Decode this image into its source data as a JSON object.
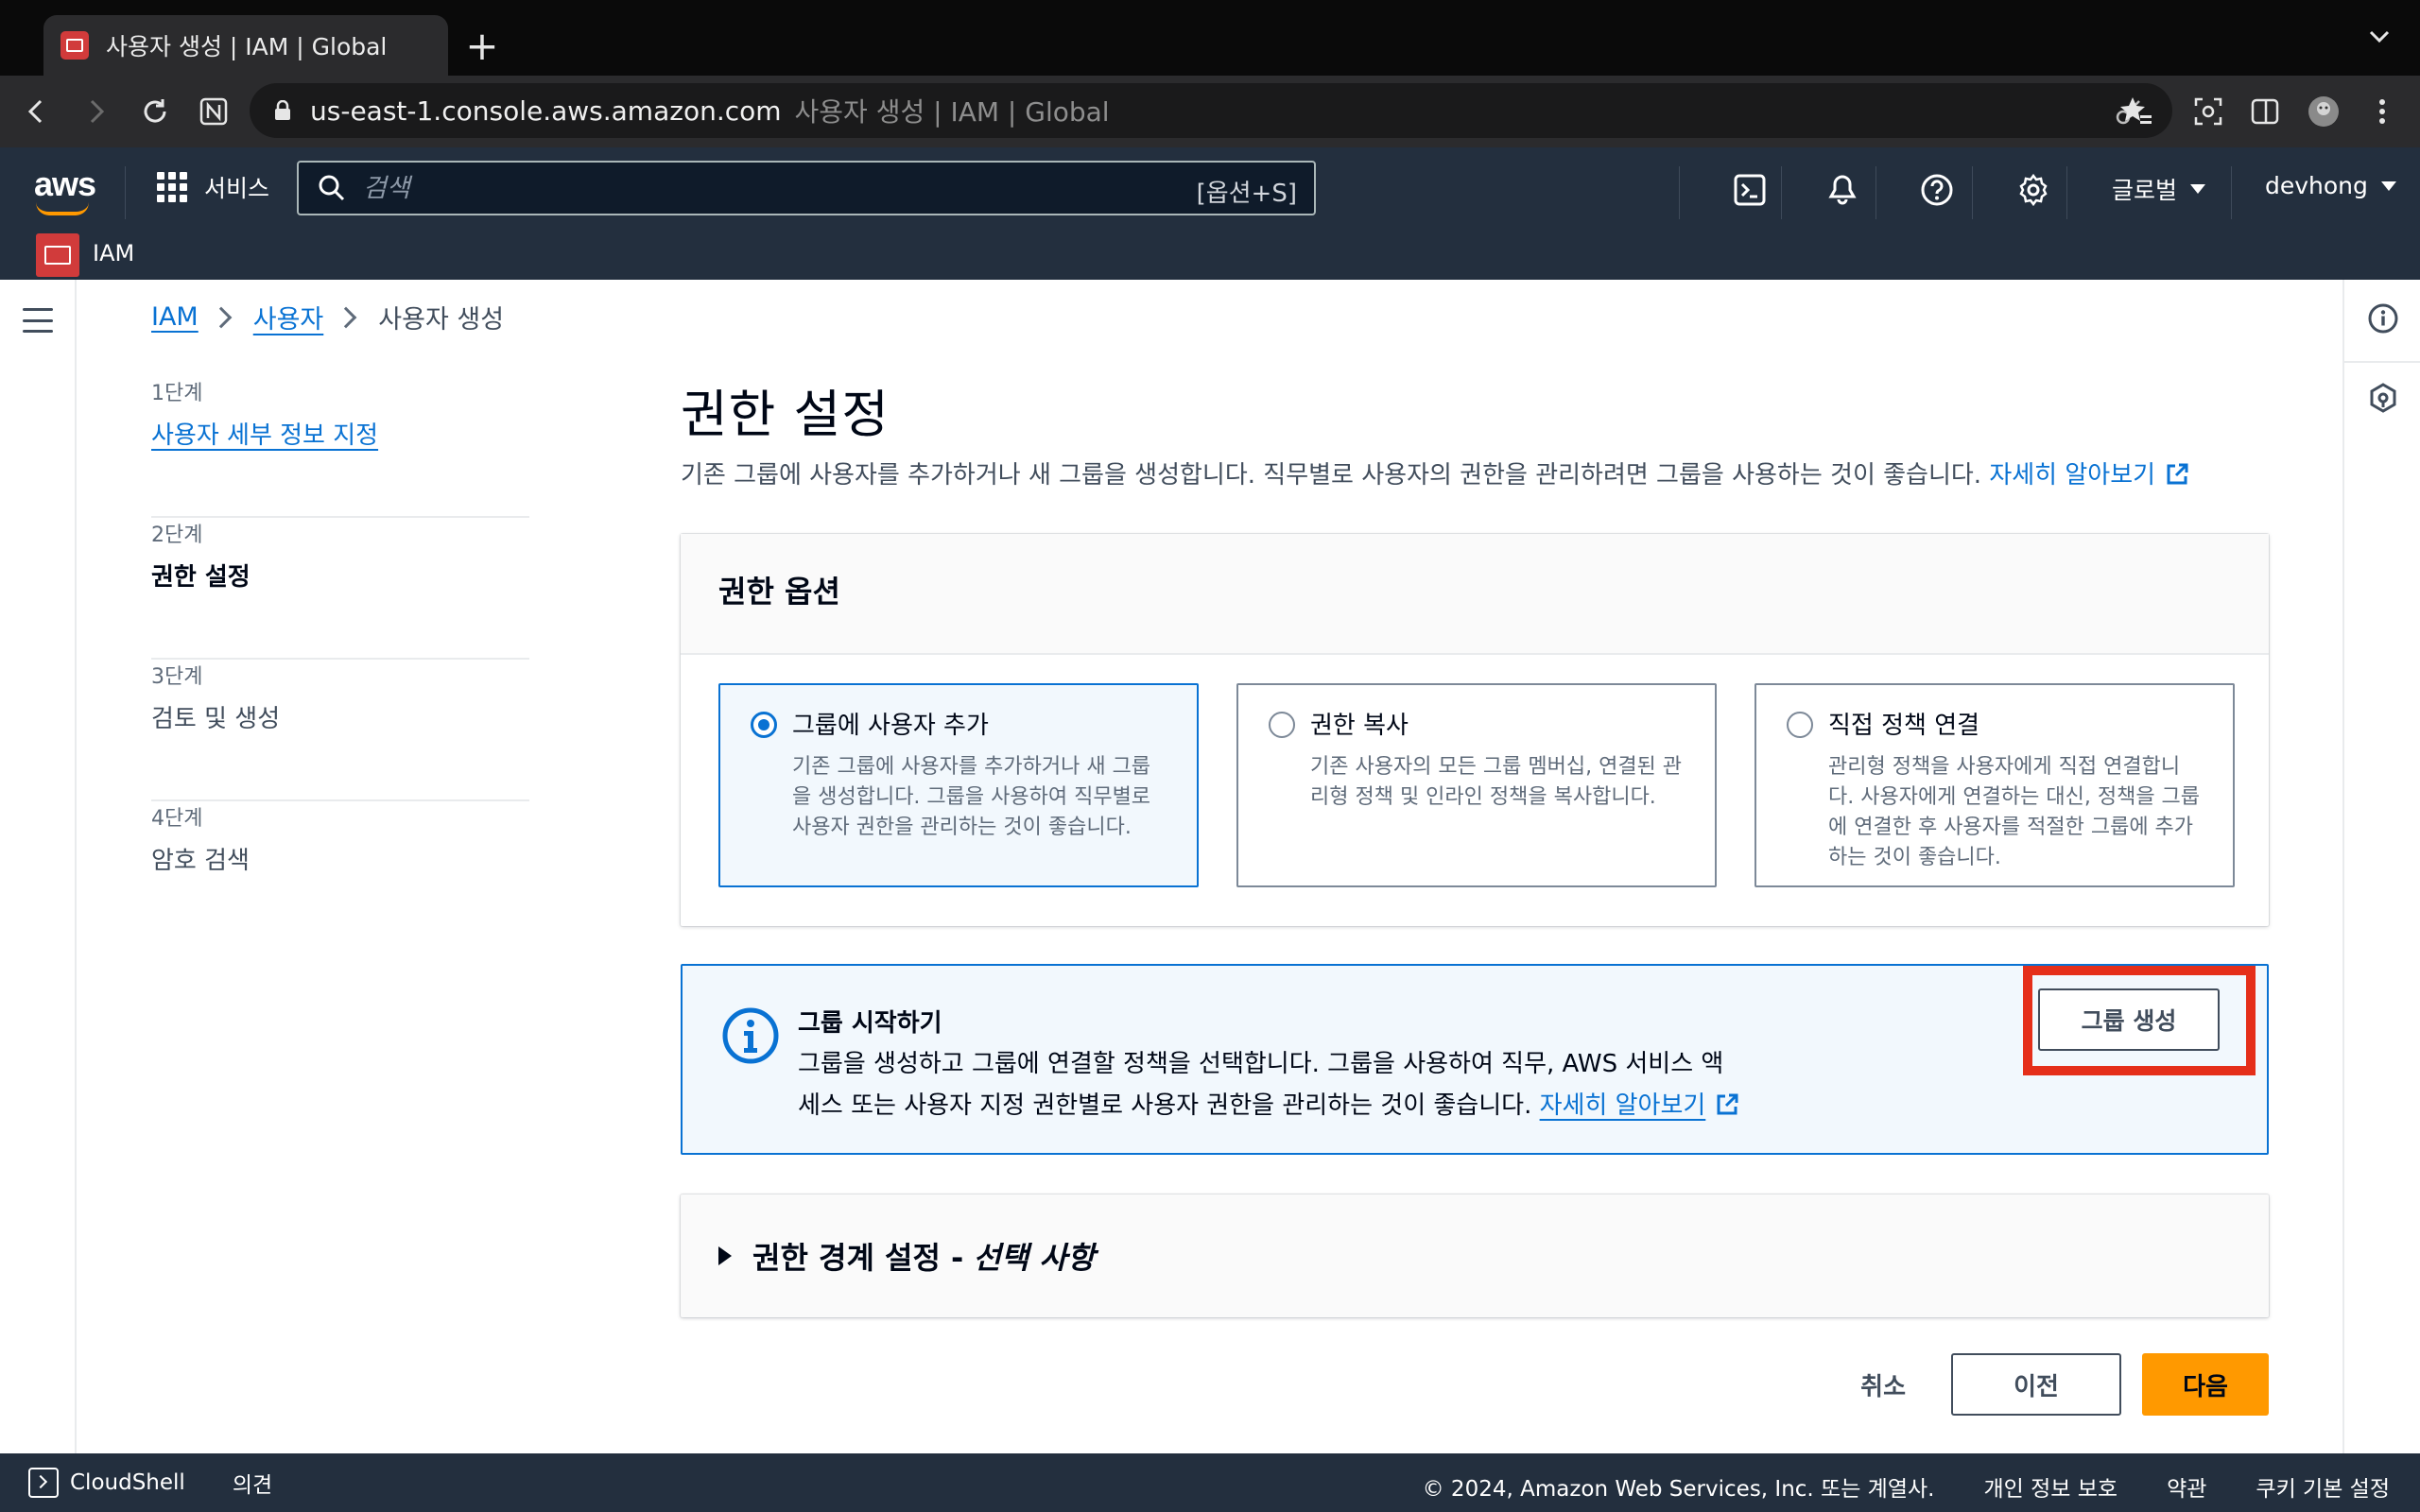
{
  "browser": {
    "tab_title": "사용자 생성 | IAM | Global",
    "new_tab": "+",
    "url": "us-east-1.console.aws.amazon.com",
    "url_page_title": "사용자 생성 | IAM | Global"
  },
  "aws_nav": {
    "logo": "aws",
    "services_label": "서비스",
    "search_placeholder": "검색",
    "search_shortcut": "[옵션+S]",
    "region_label": "글로벌",
    "account_label": "devhong",
    "service_name": "IAM"
  },
  "breadcrumb": {
    "items": [
      "IAM",
      "사용자"
    ],
    "current": "사용자 생성"
  },
  "steps": [
    {
      "num": "1단계",
      "title": "사용자 세부 정보 지정"
    },
    {
      "num": "2단계",
      "title": "권한 설정"
    },
    {
      "num": "3단계",
      "title": "검토 및 생성"
    },
    {
      "num": "4단계",
      "title": "암호 검색"
    }
  ],
  "main": {
    "title": "권한 설정",
    "description": "기존 그룹에 사용자를 추가하거나 새 그룹을 생성합니다. 직무별로 사용자의 권한을 관리하려면 그룹을 사용하는 것이 좋습니다.",
    "learn_more": "자세히 알아보기"
  },
  "permission_options": {
    "heading": "권한 옵션",
    "options": [
      {
        "title": "그룹에 사용자 추가",
        "desc": "기존 그룹에 사용자를 추가하거나 새 그룹을 생성합니다. 그룹을 사용하여 직무별로 사용자 권한을 관리하는 것이 좋습니다.",
        "selected": true
      },
      {
        "title": "권한 복사",
        "desc": "기존 사용자의 모든 그룹 멤버십, 연결된 관리형 정책 및 인라인 정책을 복사합니다.",
        "selected": false
      },
      {
        "title": "직접 정책 연결",
        "desc": "관리형 정책을 사용자에게 직접 연결합니다. 사용자에게 연결하는 대신, 정책을 그룹에 연결한 후 사용자를 적절한 그룹에 추가하는 것이 좋습니다.",
        "selected": false
      }
    ]
  },
  "info_alert": {
    "title": "그룹 시작하기",
    "body": "그룹을 생성하고 그룹에 연결할 정책을 선택합니다. 그룹을 사용하여 직무, AWS 서비스 액세스 또는 사용자 지정 권한별로 사용자 권한을 관리하는 것이 좋습니다.",
    "learn_more": "자세히 알아보기",
    "create_group_button": "그룹 생성"
  },
  "boundary": {
    "title": "권한 경계 설정 -",
    "optional": "선택 사항"
  },
  "actions": {
    "cancel": "취소",
    "previous": "이전",
    "next": "다음"
  },
  "footer": {
    "cloudshell": "CloudShell",
    "feedback": "의견",
    "copyright": "© 2024, Amazon Web Services, Inc. 또는 계열사.",
    "privacy": "개인 정보 보호",
    "terms": "약관",
    "cookies": "쿠키 기본 설정"
  },
  "colors": {
    "aws_nav_bg": "#232f3e",
    "link": "#0972d3",
    "primary_button": "#ff9900",
    "highlight": "#e52f1a"
  }
}
